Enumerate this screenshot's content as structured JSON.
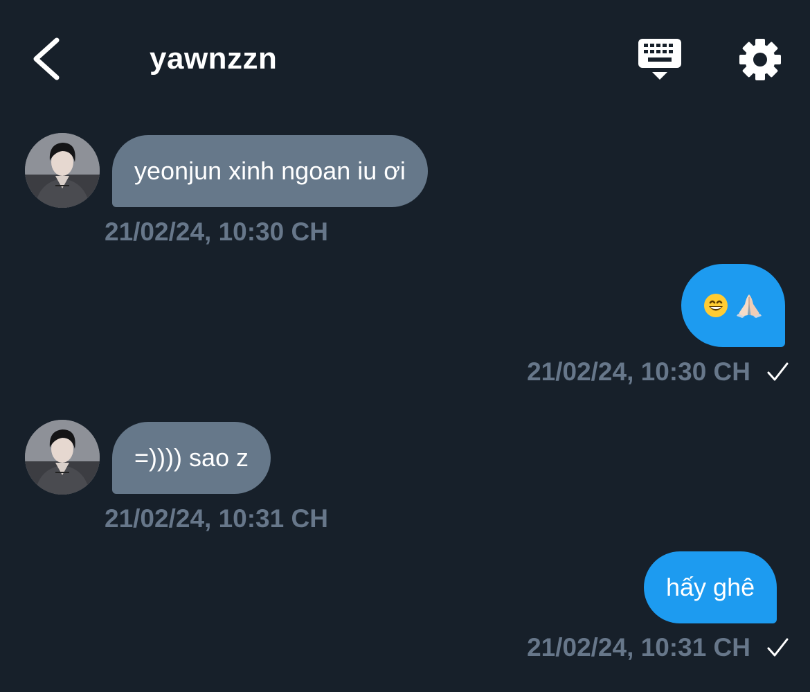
{
  "header": {
    "title": "yawnzzn",
    "back_icon": "chevron-left-icon",
    "keyboard_icon": "keyboard-icon",
    "settings_icon": "gear-icon"
  },
  "messages": [
    {
      "direction": "received",
      "text": "yeonjun xinh ngoan iu ơi",
      "timestamp": "21/02/24, 10:30 CH"
    },
    {
      "direction": "sent",
      "text": "😄🙏🏻",
      "emojis": [
        "grinning-face-emoji",
        "folded-hands-emoji"
      ],
      "timestamp": "21/02/24, 10:30 CH",
      "status_icon": "check-icon"
    },
    {
      "direction": "received",
      "text": "=)))) sao z",
      "timestamp": "21/02/24, 10:31 CH"
    },
    {
      "direction": "sent",
      "text": "hấy ghê",
      "timestamp": "21/02/24, 10:31 CH",
      "status_icon": "check-icon"
    }
  ],
  "colors": {
    "background": "#17202a",
    "received_bubble": "#66788a",
    "sent_bubble": "#1d9bf0",
    "timestamp": "#67778a",
    "text": "#ffffff"
  }
}
